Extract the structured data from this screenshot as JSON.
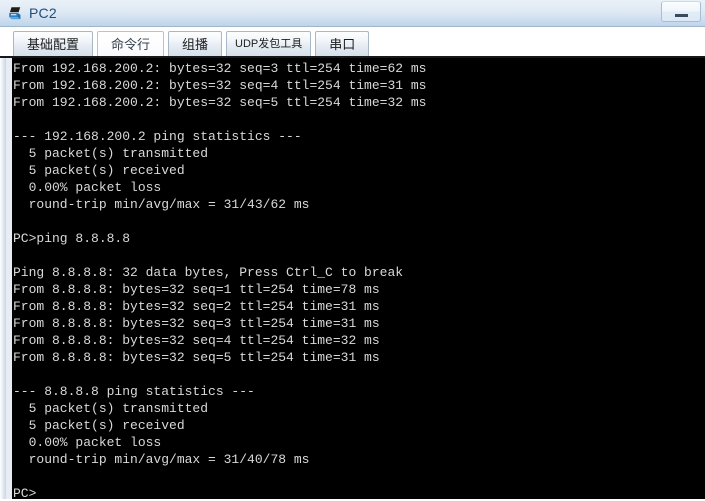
{
  "window": {
    "title": "PC2",
    "icon": "pc-device-icon",
    "controls": [
      {
        "name": "minimize-button",
        "label": "—",
        "glyph": "minimize"
      }
    ],
    "accent_color": "#1f4e79",
    "titlebar_color": "#cfdff0"
  },
  "tabs": {
    "active_index": 1,
    "items": [
      {
        "label": "基础配置",
        "name": "tab-basic-config",
        "active": false,
        "small": false
      },
      {
        "label": "命令行",
        "name": "tab-command-line",
        "active": true,
        "small": false
      },
      {
        "label": "组播",
        "name": "tab-multicast",
        "active": false,
        "small": false
      },
      {
        "label": "UDP发包工具",
        "name": "tab-udp-packet-tool",
        "active": false,
        "small": true
      },
      {
        "label": "串口",
        "name": "tab-serial-port",
        "active": false,
        "small": false
      }
    ]
  },
  "console": {
    "background_color": "#000000",
    "text_color": "#d9d9d9",
    "prompt": "PC>",
    "lines": [
      "From 192.168.200.2: bytes=32 seq=3 ttl=254 time=62 ms",
      "From 192.168.200.2: bytes=32 seq=4 ttl=254 time=31 ms",
      "From 192.168.200.2: bytes=32 seq=5 ttl=254 time=32 ms",
      "",
      "--- 192.168.200.2 ping statistics ---",
      "  5 packet(s) transmitted",
      "  5 packet(s) received",
      "  0.00% packet loss",
      "  round-trip min/avg/max = 31/43/62 ms",
      "",
      "PC>ping 8.8.8.8",
      "",
      "Ping 8.8.8.8: 32 data bytes, Press Ctrl_C to break",
      "From 8.8.8.8: bytes=32 seq=1 ttl=254 time=78 ms",
      "From 8.8.8.8: bytes=32 seq=2 ttl=254 time=31 ms",
      "From 8.8.8.8: bytes=32 seq=3 ttl=254 time=31 ms",
      "From 8.8.8.8: bytes=32 seq=4 ttl=254 time=32 ms",
      "From 8.8.8.8: bytes=32 seq=5 ttl=254 time=31 ms",
      "",
      "--- 8.8.8.8 ping statistics ---",
      "  5 packet(s) transmitted",
      "  5 packet(s) received",
      "  0.00% packet loss",
      "  round-trip min/avg/max = 31/40/78 ms",
      "",
      "PC>"
    ]
  }
}
